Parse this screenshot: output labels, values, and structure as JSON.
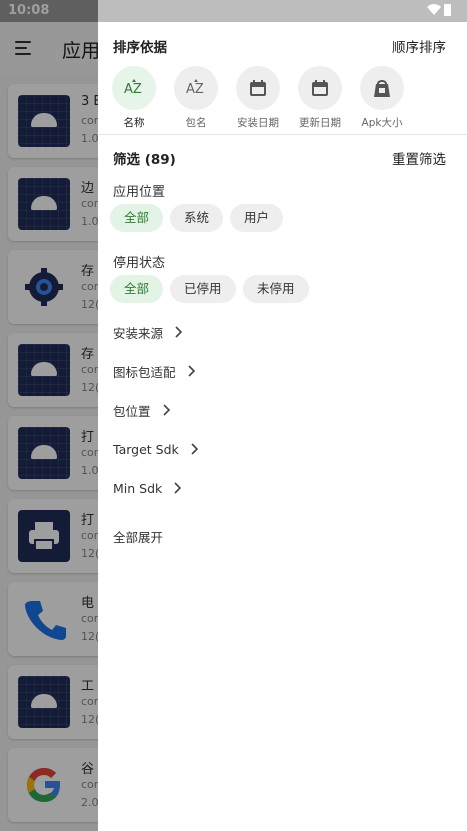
{
  "status_bar": {
    "time": "10:08"
  },
  "background": {
    "title": "应用",
    "apps": [
      {
        "name": "3 E",
        "pkg": "com",
        "ver": "1.0",
        "icon": "android-icon"
      },
      {
        "name": "边",
        "pkg": "com",
        "ver": "1.0",
        "icon": "android-icon"
      },
      {
        "name": "存",
        "pkg": "com",
        "ver": "12(",
        "icon": "settings-gear-icon"
      },
      {
        "name": "存",
        "pkg": "com",
        "ver": "12(",
        "icon": "android-icon"
      },
      {
        "name": "打",
        "pkg": "com",
        "ver": "1.0",
        "icon": "android-icon"
      },
      {
        "name": "打",
        "pkg": "com",
        "ver": "12(",
        "icon": "printer-icon"
      },
      {
        "name": "电",
        "pkg": "com",
        "ver": "12(",
        "icon": "phone-icon"
      },
      {
        "name": "工",
        "pkg": "com",
        "ver": "12(",
        "icon": "android-icon"
      },
      {
        "name": "谷",
        "pkg": "com",
        "ver": "2.0",
        "icon": "google-icon"
      }
    ]
  },
  "drawer": {
    "sort": {
      "title": "排序依据",
      "order_action": "顺序排序",
      "options": [
        {
          "label": "名称",
          "icon": "az-sort-icon",
          "active": true
        },
        {
          "label": "包名",
          "icon": "az-sort-icon",
          "active": false
        },
        {
          "label": "安装日期",
          "icon": "calendar-icon",
          "active": false
        },
        {
          "label": "更新日期",
          "icon": "calendar-icon",
          "active": false
        },
        {
          "label": "Apk大小",
          "icon": "weight-bag-icon",
          "active": false
        }
      ]
    },
    "filter": {
      "title": "筛选 (89)",
      "reset_action": "重置筛选",
      "app_location": {
        "label": "应用位置",
        "chips": [
          {
            "label": "全部",
            "selected": true
          },
          {
            "label": "系统",
            "selected": false
          },
          {
            "label": "用户",
            "selected": false
          }
        ]
      },
      "disabled_state": {
        "label": "停用状态",
        "chips": [
          {
            "label": "全部",
            "selected": true
          },
          {
            "label": "已停用",
            "selected": false
          },
          {
            "label": "未停用",
            "selected": false
          }
        ]
      },
      "expandables": [
        {
          "label": "安装来源"
        },
        {
          "label": "图标包适配"
        },
        {
          "label": "包位置"
        },
        {
          "label": "Target Sdk"
        },
        {
          "label": "Min Sdk"
        }
      ],
      "expand_all": "全部展开"
    }
  },
  "colors": {
    "accent_green": "#2e7d32",
    "chip_selected_bg": "#e3f3e6",
    "chip_bg": "#eeeeee",
    "android_tile": "#1f2d5a"
  }
}
